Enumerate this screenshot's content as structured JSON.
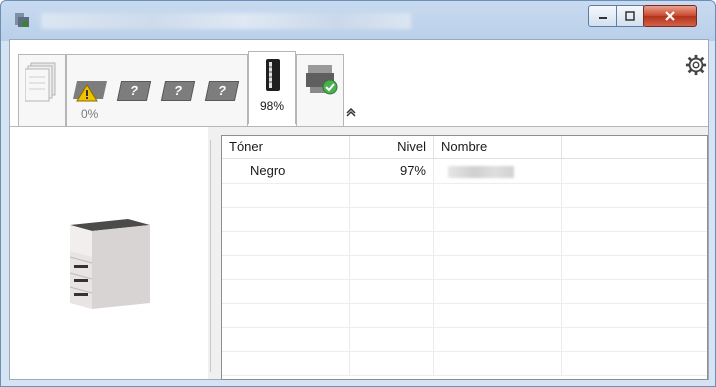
{
  "window": {
    "title_redacted": true,
    "controls": {
      "minimize": "minimize",
      "maximize": "maximize",
      "close": "close"
    }
  },
  "toolbar": {
    "tabs": [
      {
        "icon": "pages-stack-icon",
        "percent": ""
      },
      {
        "icon": "toner-warning-icon",
        "percent": "0%"
      },
      {
        "icon": "toner-unknown-icon",
        "percent": ""
      },
      {
        "icon": "toner-unknown-icon",
        "percent": ""
      },
      {
        "icon": "toner-unknown-icon",
        "percent": ""
      },
      {
        "icon": "toner-cartridge-icon",
        "percent": "98%"
      },
      {
        "icon": "device-ok-icon",
        "percent": ""
      }
    ],
    "unknown_mark": "?",
    "settings_icon": "gear-icon",
    "collapse_icon": "chevron-up-icon"
  },
  "table": {
    "columns": [
      "Tóner",
      "Nivel",
      "Nombre"
    ],
    "rows": [
      {
        "toner": "Negro",
        "level": "97%",
        "name_redacted": true
      }
    ],
    "empty_rows": 8
  },
  "colors": {
    "title_gradient": "#c8daf0",
    "close_red": "#c8462c",
    "warning_yellow": "#f2c200",
    "ok_green": "#4caf50"
  }
}
